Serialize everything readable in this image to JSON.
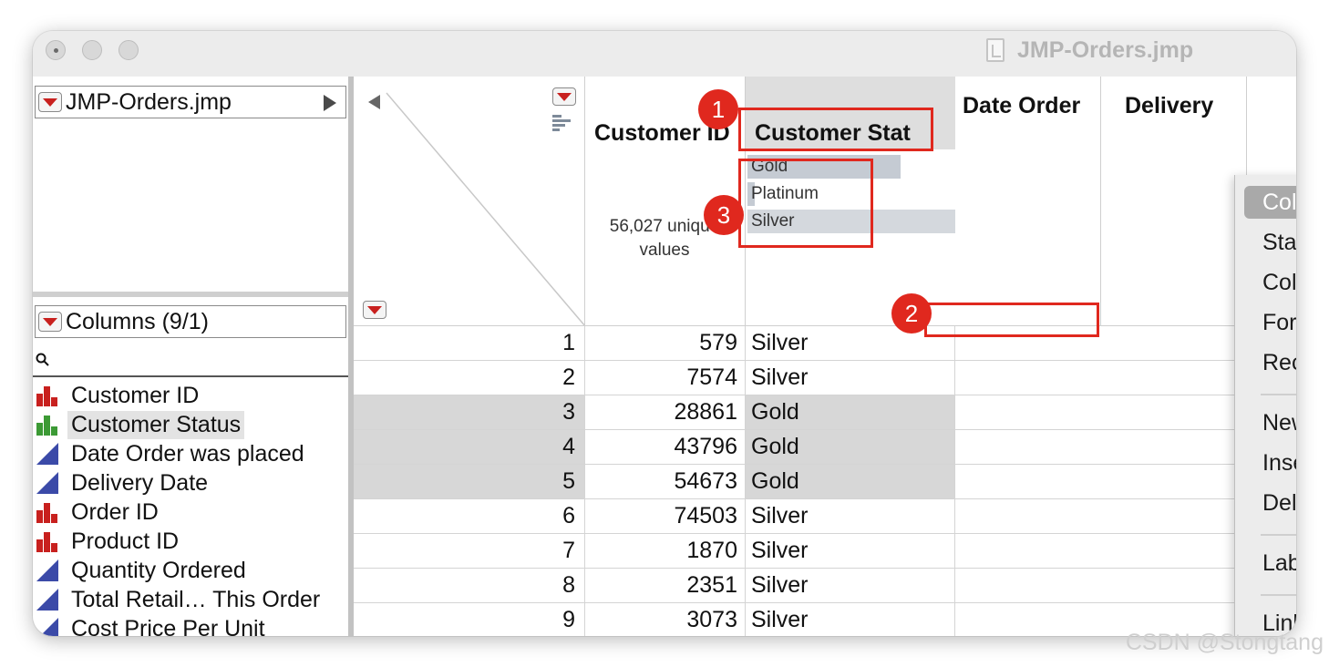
{
  "window": {
    "title": "JMP-Orders.jmp"
  },
  "table_panel": {
    "label": "JMP-Orders.jmp"
  },
  "columns_panel": {
    "label": "Columns (9/1)",
    "items": [
      {
        "label": "Customer ID",
        "type": "nominal",
        "selected": false
      },
      {
        "label": "Customer Status",
        "type": "ordinal",
        "selected": true
      },
      {
        "label": "Date Order was placed",
        "type": "continuous",
        "selected": false
      },
      {
        "label": "Delivery Date",
        "type": "continuous",
        "selected": false
      },
      {
        "label": "Order ID",
        "type": "nominal",
        "selected": false
      },
      {
        "label": "Product ID",
        "type": "nominal",
        "selected": false
      },
      {
        "label": "Quantity Ordered",
        "type": "continuous",
        "selected": false
      },
      {
        "label": "Total Retail… This Order",
        "type": "continuous",
        "selected": false
      },
      {
        "label": "Cost Price Per Unit",
        "type": "continuous",
        "selected": false
      }
    ]
  },
  "grid": {
    "columns": {
      "customer_id": "Customer ID",
      "customer_status": "Customer Stat",
      "date_order": "Date Order",
      "delivery": "Delivery"
    },
    "customer_id_summary": "56,027 unique values",
    "status_levels": [
      "Gold",
      "Platinum",
      "Silver"
    ],
    "rows": [
      {
        "n": "1",
        "id": "579",
        "status": "Silver",
        "shaded": false
      },
      {
        "n": "2",
        "id": "7574",
        "status": "Silver",
        "shaded": false
      },
      {
        "n": "3",
        "id": "28861",
        "status": "Gold",
        "shaded": true
      },
      {
        "n": "4",
        "id": "43796",
        "status": "Gold",
        "shaded": true
      },
      {
        "n": "5",
        "id": "54673",
        "status": "Gold",
        "shaded": true
      },
      {
        "n": "6",
        "id": "74503",
        "status": "Silver",
        "shaded": false
      },
      {
        "n": "7",
        "id": "1870",
        "status": "Silver",
        "shaded": false
      },
      {
        "n": "8",
        "id": "2351",
        "status": "Silver",
        "shaded": false
      },
      {
        "n": "9",
        "id": "3073",
        "status": "Silver",
        "shaded": false
      }
    ]
  },
  "context_menu": {
    "column_info": "Column Info...",
    "standardize": "Standardize Attributes...",
    "column_properties": "Column Properties",
    "formula": "Formula...",
    "recode": "Recode...",
    "new_formula_column": "New Formula Column",
    "insert_columns": "Insert Columns",
    "delete_columns": "Delete Columns",
    "label_unlabel": "Label/Unlabel",
    "link_id": "Link ID",
    "submenu_chevron": "›"
  },
  "annotations": {
    "badge1": "1",
    "badge2": "2",
    "badge3": "3"
  },
  "watermark": "CSDN @Stongtang",
  "colors": {
    "annotation_red": "#e0281e",
    "menu_highlight": "#a9a9a9",
    "selected_row": "#d7d7d7"
  }
}
